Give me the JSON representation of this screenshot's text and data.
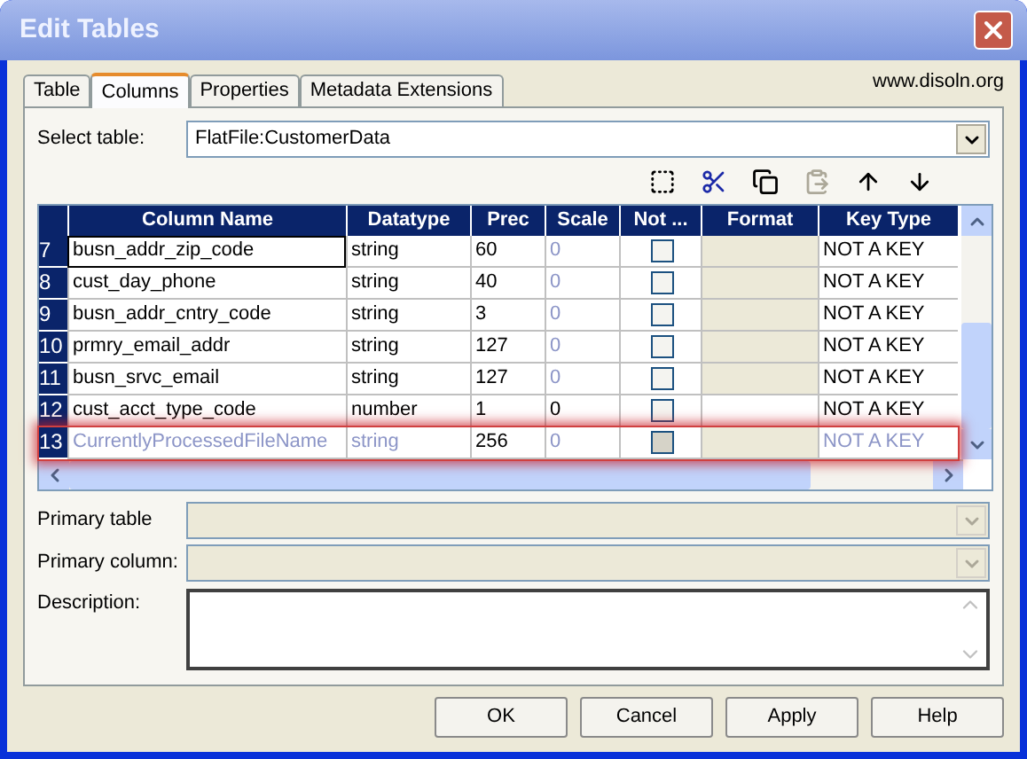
{
  "window": {
    "title": "Edit Tables"
  },
  "tabs": [
    {
      "label": "Table",
      "selected": false
    },
    {
      "label": "Columns",
      "selected": true
    },
    {
      "label": "Properties",
      "selected": false
    },
    {
      "label": "Metadata Extensions",
      "selected": false
    }
  ],
  "site_label": "www.disoln.org",
  "select_table": {
    "label": "Select table:",
    "value": "FlatFile:CustomerData"
  },
  "toolbar": [
    {
      "kind": "new",
      "disabled": false
    },
    {
      "kind": "cut",
      "disabled": false
    },
    {
      "kind": "copy",
      "disabled": false
    },
    {
      "kind": "paste",
      "disabled": true
    },
    {
      "kind": "up",
      "disabled": false
    },
    {
      "kind": "down",
      "disabled": false
    }
  ],
  "table": {
    "columns": [
      "Column Name",
      "Datatype",
      "Prec",
      "Scale",
      "Not ...",
      "Format",
      "Key Type"
    ],
    "rows": [
      {
        "number": "7",
        "name": "busn_addr_zip_code",
        "datatype": "string",
        "prec": "60",
        "scale": "0",
        "not_null": false,
        "key_type": "NOT A KEY",
        "scale_disabled": true,
        "focused": true,
        "disabled": false,
        "highlighted": false
      },
      {
        "number": "8",
        "name": "cust_day_phone",
        "datatype": "string",
        "prec": "40",
        "scale": "0",
        "not_null": false,
        "key_type": "NOT A KEY",
        "scale_disabled": true,
        "focused": false,
        "disabled": false,
        "highlighted": false
      },
      {
        "number": "9",
        "name": "busn_addr_cntry_code",
        "datatype": "string",
        "prec": "3",
        "scale": "0",
        "not_null": false,
        "key_type": "NOT A KEY",
        "scale_disabled": true,
        "focused": false,
        "disabled": false,
        "highlighted": false
      },
      {
        "number": "10",
        "name": "prmry_email_addr",
        "datatype": "string",
        "prec": "127",
        "scale": "0",
        "not_null": false,
        "key_type": "NOT A KEY",
        "scale_disabled": true,
        "focused": false,
        "disabled": false,
        "highlighted": false
      },
      {
        "number": "11",
        "name": "busn_srvc_email",
        "datatype": "string",
        "prec": "127",
        "scale": "0",
        "not_null": false,
        "key_type": "NOT A KEY",
        "scale_disabled": true,
        "focused": false,
        "disabled": false,
        "highlighted": false
      },
      {
        "number": "12",
        "name": "cust_acct_type_code",
        "datatype": "number",
        "prec": "1",
        "scale": "0",
        "not_null": false,
        "key_type": "NOT A KEY",
        "scale_disabled": false,
        "focused": false,
        "disabled": false,
        "highlighted": false
      },
      {
        "number": "13",
        "name": "CurrentlyProcessedFileName",
        "datatype": "string",
        "prec": "256",
        "scale": "0",
        "not_null": false,
        "key_type": "NOT A KEY",
        "scale_disabled": true,
        "focused": false,
        "disabled": true,
        "highlighted": true
      }
    ]
  },
  "primary_table": {
    "label": "Primary table",
    "disabled": true
  },
  "primary_column": {
    "label": "Primary column:",
    "disabled": true
  },
  "description": {
    "label": "Description:"
  },
  "buttons": [
    "OK",
    "Cancel",
    "Apply",
    "Help"
  ]
}
